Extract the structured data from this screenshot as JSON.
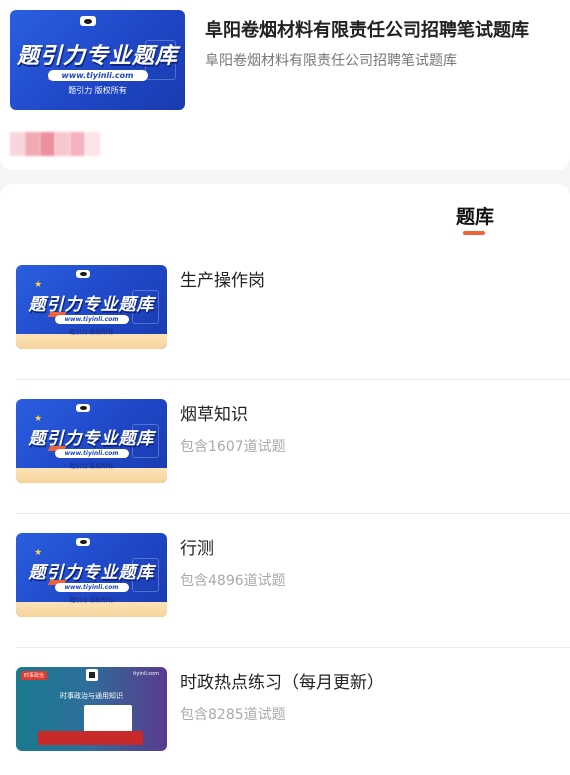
{
  "header": {
    "cover": {
      "slogan": "题引力专业题库",
      "url": "www.tiyinli.com",
      "rights": "题引力 版权所有"
    },
    "title": "阜阳卷烟材料有限责任公司招聘笔试题库",
    "subtitle": "阜阳卷烟材料有限责任公司招聘笔试题库"
  },
  "tab": {
    "label": "题库"
  },
  "items": [
    {
      "name": "生产操作岗",
      "count": "",
      "cover": {
        "slogan": "题引力专业题库",
        "url": "www.tiyinli.com",
        "rights": "题引力 版权所有"
      }
    },
    {
      "name": "烟草知识",
      "count": "包含1607道试题",
      "cover": {
        "slogan": "题引力专业题库",
        "url": "www.tiyinli.com",
        "rights": "题引力 版权所有"
      }
    },
    {
      "name": "行测",
      "count": "包含4896道试题",
      "cover": {
        "slogan": "题引力专业题库",
        "url": "www.tiyinli.com",
        "rights": "题引力 版权所有"
      }
    },
    {
      "name": "时政热点练习（每月更新）",
      "count": "包含8285道试题",
      "cover": {
        "tag": "时事政治",
        "site": "tiyinli.com",
        "headline": "时事政治与通用知识"
      }
    }
  ],
  "colors": {
    "accent": "#f0633a",
    "cover_blue": "#1f47c7"
  },
  "icons": [
    "logo-icon",
    "star-icon",
    "arrow-icon"
  ]
}
